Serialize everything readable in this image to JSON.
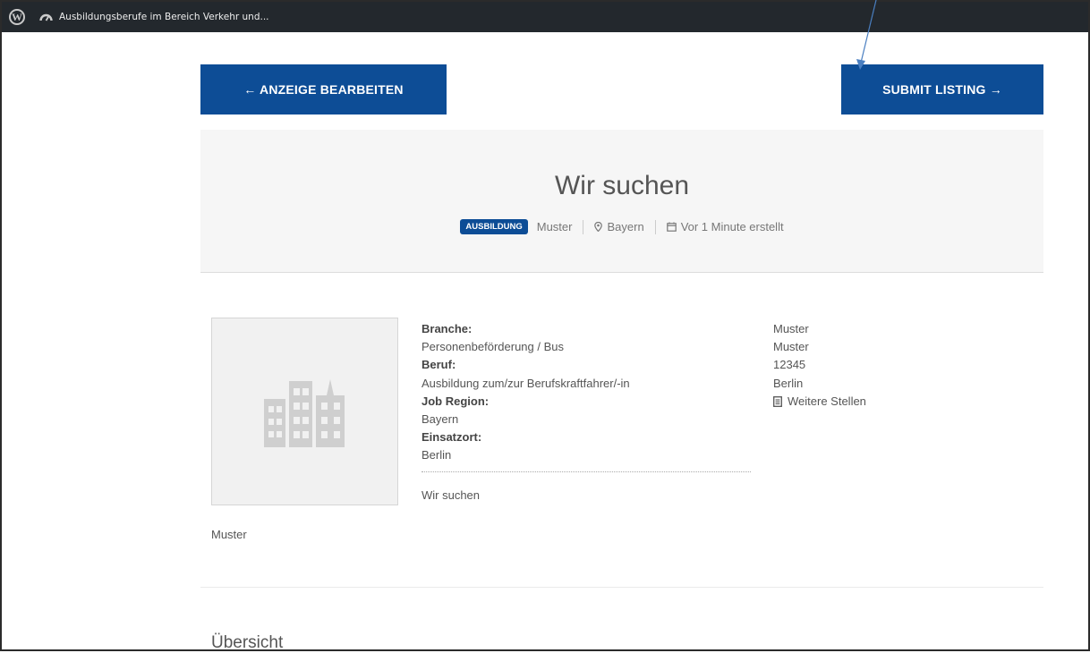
{
  "adminbar": {
    "site_name": "Ausbildungsberufe im Bereich Verkehr und...",
    "wp_logo_icon": "wordpress-logo-icon",
    "dashboard_icon": "dashboard-icon"
  },
  "toolbar": {
    "edit_label": "← ANZEIGE BEARBEITEN",
    "submit_label": "SUBMIT LISTING →"
  },
  "listing": {
    "title": "Wir suchen",
    "badge": "AUSBILDUNG",
    "company": "Muster",
    "location": "Bayern",
    "posted": "Vor 1 Minute erstellt"
  },
  "details": {
    "branche_label": "Branche:",
    "branche_value": "Personenbeförderung / Bus",
    "beruf_label": "Beruf:",
    "beruf_value": "Ausbildung zum/zur Berufskraftfahrer/-in",
    "region_label": "Job Region:",
    "region_value": "Bayern",
    "einsatzort_label": "Einsatzort:",
    "einsatzort_value": "Berlin",
    "description": "Wir suchen"
  },
  "contact": {
    "line1": "Muster",
    "line2": "Muster",
    "line3": "12345",
    "line4": "Berlin",
    "more_jobs": "Weitere Stellen"
  },
  "company_caption": "Muster",
  "section_heading": "Übersicht",
  "colors": {
    "primary": "#0d4d96",
    "adminbar": "#23282d",
    "panel": "#f6f6f6",
    "annotation_arrow": "#4a7fc1"
  }
}
